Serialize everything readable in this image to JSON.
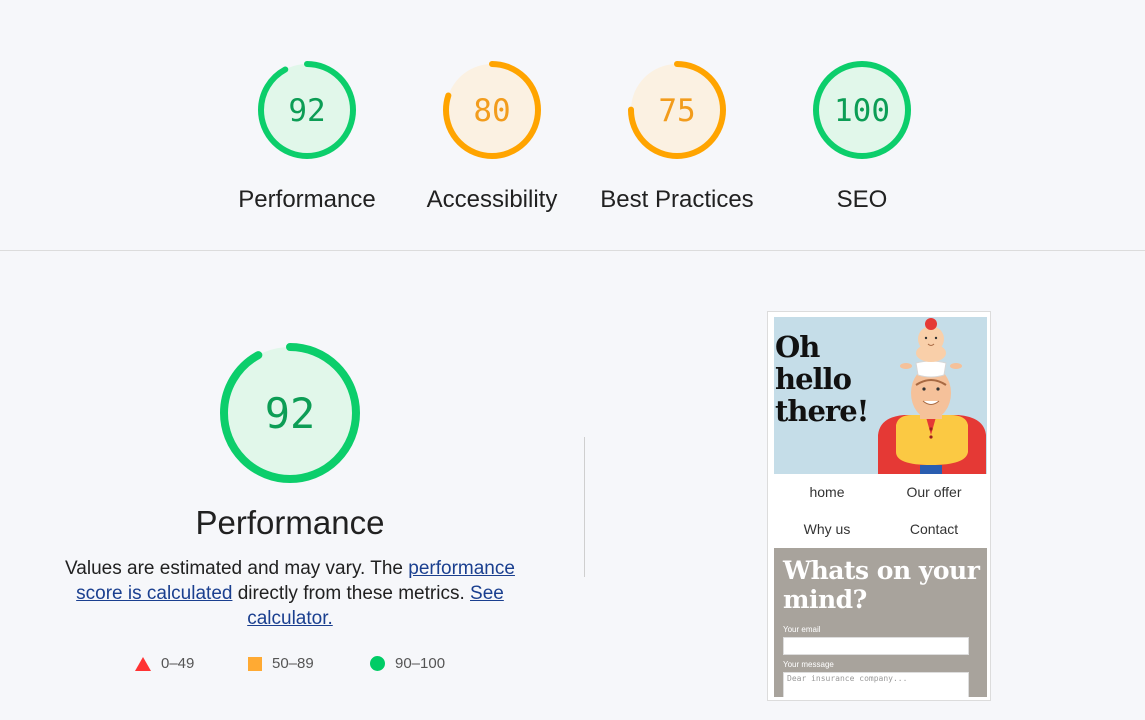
{
  "scores": [
    {
      "name": "Performance",
      "value": "92",
      "fraction": 0.92,
      "status": "pass"
    },
    {
      "name": "Accessibility",
      "value": "80",
      "fraction": 0.8,
      "status": "average"
    },
    {
      "name": "Best Practices",
      "value": "75",
      "fraction": 0.75,
      "status": "average"
    },
    {
      "name": "SEO",
      "value": "100",
      "fraction": 1.0,
      "status": "pass"
    }
  ],
  "colors": {
    "pass": "#0cce6b",
    "pass_text": "#0c9d55",
    "pass_bg": "#e1f7ea",
    "average": "#ffa400",
    "average_text": "#f29c1c",
    "average_bg": "#fbf1e2",
    "fail": "#ff3333",
    "link": "#1a3f8f"
  },
  "performance": {
    "score": "92",
    "fraction": 0.92,
    "title": "Performance",
    "desc_1": "Values are estimated and may vary. The ",
    "link_1": "performance score is calculated",
    "desc_2": " directly from these metrics. ",
    "link_2": "See calculator."
  },
  "legend": [
    {
      "range": "0–49",
      "icon": "triangle-icon"
    },
    {
      "range": "50–89",
      "icon": "square-icon"
    },
    {
      "range": "90–100",
      "icon": "circle-icon"
    }
  ],
  "screenshot": {
    "hero_line1": "Oh",
    "hero_line2": "hello",
    "hero_line3": "there!",
    "nav": [
      "home",
      "Our offer",
      "Why us",
      "Contact"
    ],
    "contact_title_1": "Whats on your",
    "contact_title_2": "mind?",
    "email_label": "Your email",
    "message_label": "Your message",
    "message_placeholder": "Dear insurance company..."
  }
}
